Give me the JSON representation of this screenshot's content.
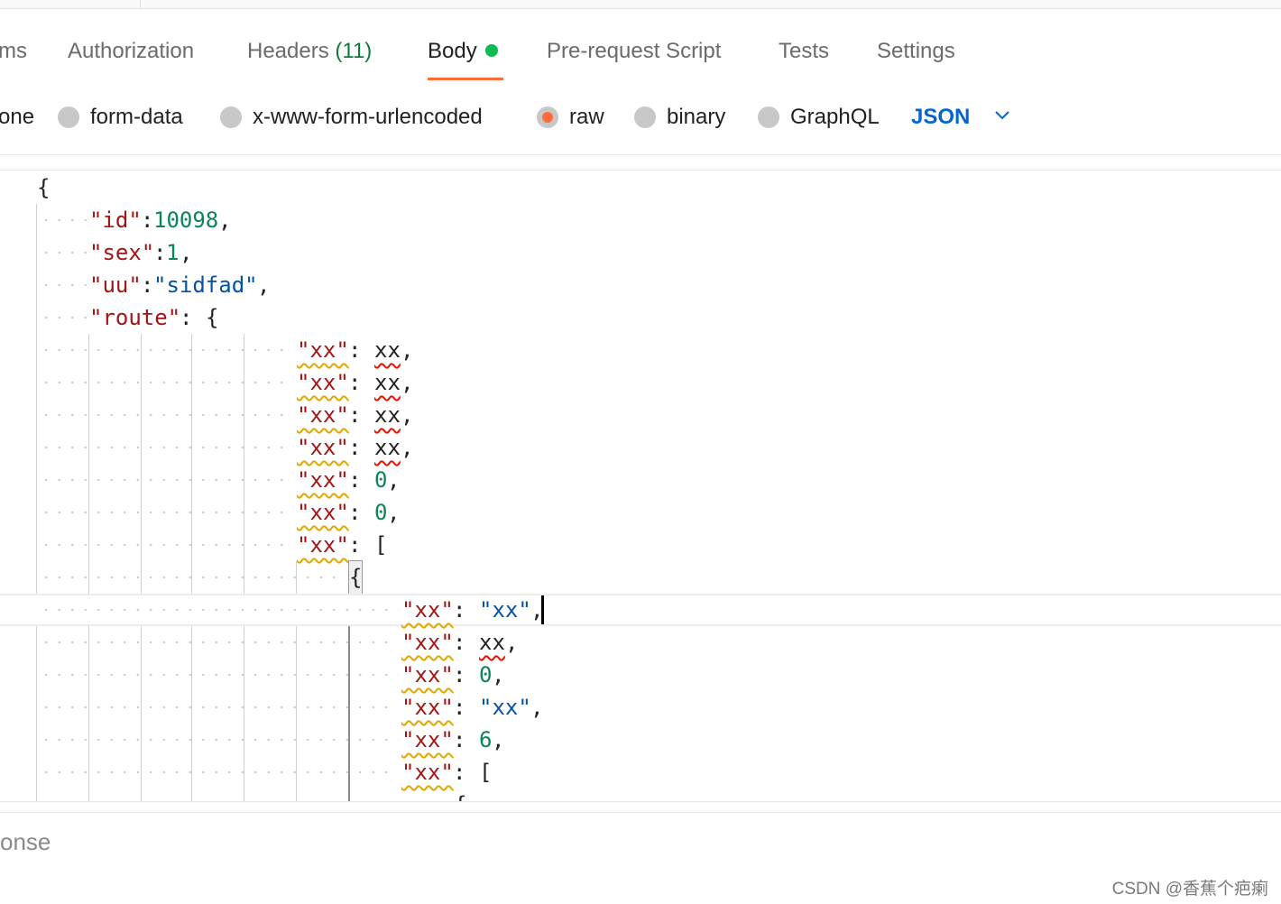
{
  "tabs": [
    {
      "label": "ms"
    },
    {
      "label": "Authorization"
    },
    {
      "label": "Headers"
    },
    {
      "label": "Body"
    },
    {
      "label": "Pre-request Script"
    },
    {
      "label": "Tests"
    },
    {
      "label": "Settings"
    }
  ],
  "headers_count": "(11)",
  "active_tab": "Body",
  "body_types": [
    {
      "label": "one"
    },
    {
      "label": "form-data"
    },
    {
      "label": "x-www-form-urlencoded"
    },
    {
      "label": "raw"
    },
    {
      "label": "binary"
    },
    {
      "label": "GraphQL"
    }
  ],
  "selected_body_type": "raw",
  "language": "JSON",
  "editor": {
    "l1_open": "{",
    "id_key": "\"id\"",
    "id_val": "10098",
    "sex_key": "\"sex\"",
    "sex_val": "1",
    "uu_key": "\"uu\"",
    "uu_val": "\"sidfad\"",
    "route_key": "\"route\"",
    "k_xx": "\"xx\"",
    "v_xx": "xx",
    "v_zero": "0",
    "v_six": "6",
    "v_str": "\"xx\"",
    "open_bracket": "[",
    "open_brace": "{"
  },
  "response_label": "onse",
  "watermark": "CSDN @香蕉个疤瘌",
  "colors": {
    "accent": "#ff6c37",
    "status_dot": "#0cbb52",
    "json_link": "#0265d2"
  },
  "icons": [
    "chevron-down-icon",
    "radio-icon",
    "status-dot-icon"
  ]
}
